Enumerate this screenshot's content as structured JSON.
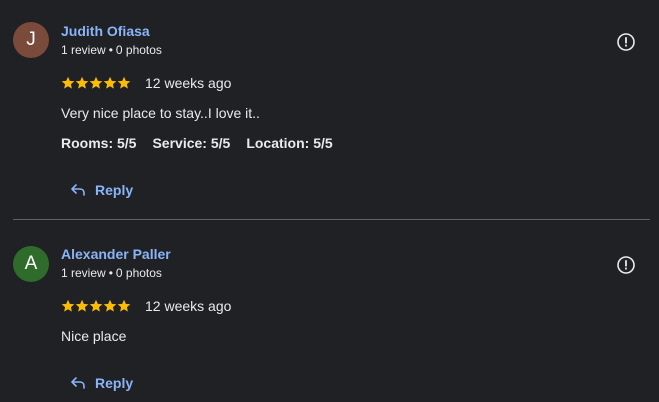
{
  "reviews": [
    {
      "avatar_letter": "J",
      "avatar_color": "#7a4a3a",
      "author": "Judith Ofiasa",
      "review_count": "1 review",
      "photo_count": "0 photos",
      "meta_separator": "•",
      "stars": 5,
      "time": "12 weeks ago",
      "text": "Very nice place to stay..I love it..",
      "subratings": [
        {
          "label": "Rooms: 5/5"
        },
        {
          "label": "Service: 5/5"
        },
        {
          "label": "Location: 5/5"
        }
      ],
      "reply_label": "Reply"
    },
    {
      "avatar_letter": "A",
      "avatar_color": "#2f6b2a",
      "author": "Alexander Paller",
      "review_count": "1 review",
      "photo_count": "0 photos",
      "meta_separator": "•",
      "stars": 5,
      "time": "12 weeks ago",
      "text": "Nice place",
      "reply_label": "Reply"
    }
  ],
  "colors": {
    "background": "#202124",
    "link": "#8ab4f8",
    "star": "#fbbc04",
    "divider": "#5f6368"
  },
  "icons": {
    "flag": "report-flag-icon",
    "reply": "reply-arrow-icon",
    "star": "star-icon"
  }
}
